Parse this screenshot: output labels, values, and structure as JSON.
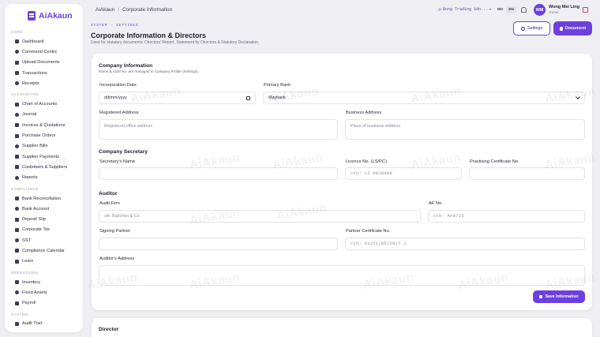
{
  "app": {
    "name": "AiAkaun"
  },
  "sidebar": {
    "sections": [
      {
        "title": "CORE",
        "items": [
          {
            "label": "Dashboard",
            "icon": "grid-icon"
          },
          {
            "label": "Command Centre",
            "icon": "command-icon"
          },
          {
            "label": "Upload Documents",
            "icon": "upload-icon"
          },
          {
            "label": "Transactions",
            "icon": "transactions-icon"
          },
          {
            "label": "Receipts",
            "icon": "receipt-icon"
          }
        ]
      },
      {
        "title": "ACCOUNTING",
        "items": [
          {
            "label": "Chart of Accounts",
            "icon": "chart-icon"
          },
          {
            "label": "Journal",
            "icon": "journal-icon"
          },
          {
            "label": "Invoices & Quotations",
            "icon": "invoice-icon"
          },
          {
            "label": "Purchase Orders",
            "icon": "purchase-icon"
          },
          {
            "label": "Supplier Bills",
            "icon": "bill-icon"
          },
          {
            "label": "Supplier Payments",
            "icon": "payment-icon"
          },
          {
            "label": "Customers & Suppliers",
            "icon": "people-icon"
          },
          {
            "label": "Reports",
            "icon": "report-icon"
          }
        ]
      },
      {
        "title": "COMPLIANCE",
        "items": [
          {
            "label": "Bank Reconciliation",
            "icon": "check-icon"
          },
          {
            "label": "Bank Account",
            "icon": "bank-icon"
          },
          {
            "label": "Deposit Slip",
            "icon": "deposit-icon"
          },
          {
            "label": "Corporate Tax",
            "icon": "tax-icon"
          },
          {
            "label": "SST",
            "icon": "sst-icon"
          },
          {
            "label": "Compliance Calendar",
            "icon": "calendar-icon"
          },
          {
            "label": "Learn",
            "icon": "learn-icon"
          }
        ]
      },
      {
        "title": "OPERATIONS",
        "items": [
          {
            "label": "Inventory",
            "icon": "inventory-icon"
          },
          {
            "label": "Fixed Assets",
            "icon": "assets-icon"
          },
          {
            "label": "Payroll",
            "icon": "payroll-icon"
          }
        ]
      },
      {
        "title": "SYSTEM",
        "items": [
          {
            "label": "Audit Trail",
            "icon": "audit-icon"
          }
        ]
      }
    ]
  },
  "header": {
    "breadcrumb": [
      "AiAkaun",
      "Corporate Information"
    ],
    "breadcrumb_sep": "/",
    "company": "Bong Trading Sdn...",
    "langs": [
      "MS",
      "EN"
    ],
    "user_initials": "WM",
    "user_name": "Wong Mei Ling",
    "user_role": "Owner"
  },
  "page": {
    "crumb": "SYSTEM · SETTINGS",
    "title": "Corporate Information & Directors",
    "subtitle": "Used for statutory documents: Directors' Report, Statement by Directors & Statutory Declaration.",
    "settings_btn": "Settings",
    "document_btn": "Document"
  },
  "company_info": {
    "title": "Company Information",
    "subtitle": "Name & SSM No. are managed in Company Profile (Settings).",
    "incorporation_label": "Incorporation Date",
    "incorporation_value": "dd/mm/yyyy",
    "bank_label": "Primary Bank",
    "bank_value": "Maybank",
    "reg_addr_label": "Registered Address",
    "reg_addr_placeholder": "Registered office address",
    "biz_addr_label": "Business Address",
    "biz_addr_placeholder": "Place of business address"
  },
  "secretary": {
    "title": "Company Secretary",
    "name_label": "Secretary's Name",
    "licence_label": "Licence No. (LS/PC)",
    "licence_placeholder": "cth: LS 0010488",
    "cert_label": "Practising Certificate No."
  },
  "auditor": {
    "title": "Auditor",
    "firm_label": "Audit Firm",
    "firm_placeholder": "cth: Baltchoo & Co",
    "af_label": "AF No.",
    "af_placeholder": "cth: AF0715",
    "partner_label": "Signing Partner",
    "partner_cert_label": "Partner Certificate No.",
    "partner_cert_placeholder": "cth: 01371/05/2027 J",
    "address_label": "Auditor's Address"
  },
  "save_btn": "Save Information",
  "director": {
    "title": "Director"
  },
  "watermark": "AiAkaun",
  "colors": {
    "accent": "#6d3fe0",
    "background": "#efeff3",
    "card": "#ffffff",
    "danger": "#d0455a"
  }
}
